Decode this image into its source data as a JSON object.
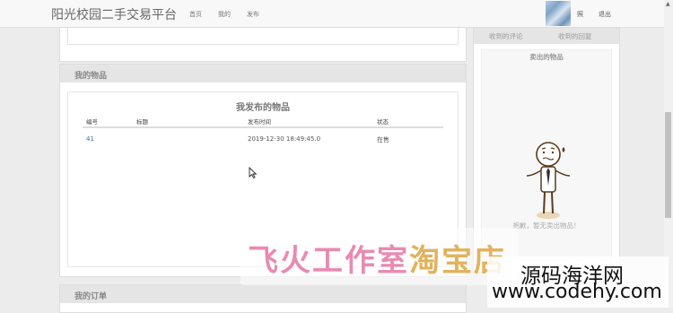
{
  "header": {
    "brand": "阳光校园二手交易平台",
    "nav": [
      "首页",
      "我的",
      "发布"
    ],
    "user_name": "照",
    "logout": "退出"
  },
  "my_goods": {
    "panel_title": "我的物品",
    "box_title": "我发布的物品",
    "columns": [
      "编号",
      "标题",
      "发布时间",
      "状态"
    ],
    "rows": [
      {
        "id": "41",
        "title": "",
        "time": "2019-12-30 18:49:45.0",
        "status": "在售"
      }
    ]
  },
  "orders": {
    "panel_title": "我的订单"
  },
  "sidebar": {
    "tabs": [
      "收到的评论",
      "收到的回复"
    ],
    "sold_title": "卖出的物品",
    "empty_text": "抱歉，暂无卖出物品！"
  },
  "watermark": {
    "studio_pink": "飞火工作室",
    "studio_gold": "淘宝店",
    "site_name": "源码海洋网",
    "site_url": "www.codehy.com"
  },
  "colors": {
    "link": "#3b6ea5",
    "panel_head": "#e5e5e5",
    "watermark_pink": "#e98ab2",
    "watermark_gold": "#e2b25c"
  }
}
